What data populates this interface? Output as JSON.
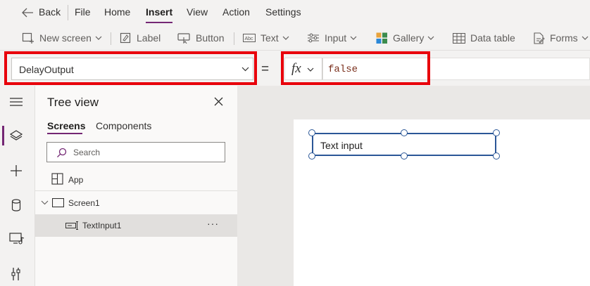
{
  "menu": {
    "back_label": "Back",
    "items": [
      "File",
      "Home",
      "Insert",
      "View",
      "Action",
      "Settings"
    ],
    "active": "Insert"
  },
  "toolbar": {
    "new_screen": "New screen",
    "label": "Label",
    "button": "Button",
    "text": "Text",
    "input": "Input",
    "gallery": "Gallery",
    "data_table": "Data table",
    "forms": "Forms"
  },
  "formula_bar": {
    "property": "DelayOutput",
    "equals": "=",
    "fx": "fx",
    "formula": "false"
  },
  "tree_view": {
    "title": "Tree view",
    "tabs": [
      "Screens",
      "Components"
    ],
    "active_tab": "Screens",
    "search_placeholder": "Search",
    "items": [
      {
        "label": "App"
      },
      {
        "label": "Screen1"
      },
      {
        "label": "TextInput1",
        "selected": true,
        "more": "···"
      }
    ]
  },
  "canvas": {
    "text_input_value": "Text input"
  },
  "colors": {
    "accent": "#742774",
    "highlight": "#e8000b",
    "selection": "#2b5797",
    "formula_text": "#7a2e1b"
  }
}
